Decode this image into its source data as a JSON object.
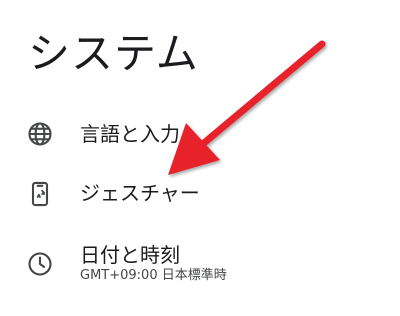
{
  "page": {
    "title": "システム"
  },
  "settings": {
    "items": [
      {
        "id": "language",
        "label": "言語と入力",
        "icon": "globe-icon"
      },
      {
        "id": "gestures",
        "label": "ジェスチャー",
        "icon": "gesture-phone-icon"
      },
      {
        "id": "datetime",
        "label": "日付と時刻",
        "sublabel": "GMT+09:00 日本標準時",
        "icon": "clock-icon"
      }
    ]
  },
  "annotation": {
    "arrow_color": "#e8202a",
    "icon_color": "#444746",
    "text_color": "#1c1b1f"
  }
}
